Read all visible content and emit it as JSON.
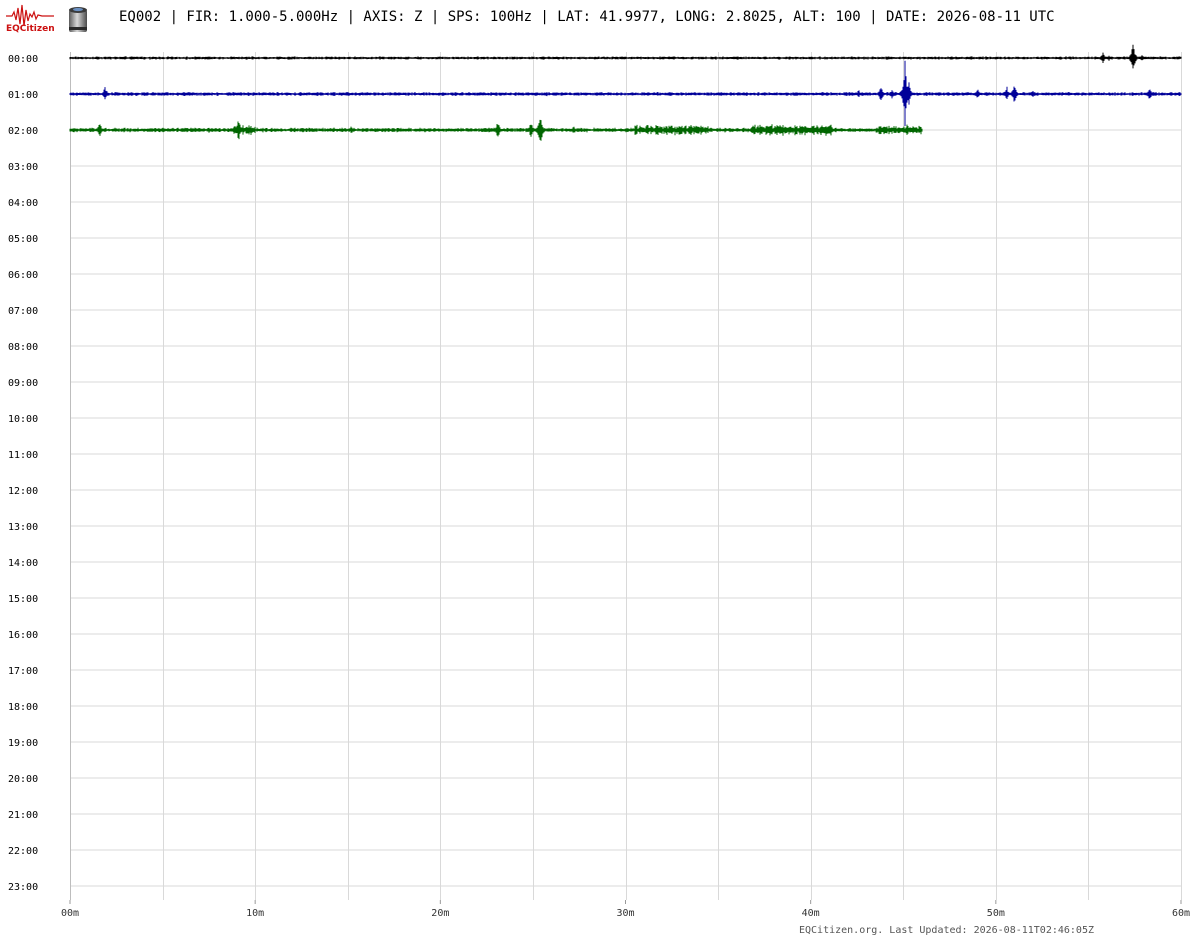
{
  "header": {
    "logo_text": "EQCitizen",
    "title": "EQ002 | FIR: 1.000-5.000Hz | AXIS: Z | SPS: 100Hz | LAT: 41.9977, LONG: 2.8025, ALT: 100 | DATE: 2026-08-11 UTC"
  },
  "footer": {
    "text": "EQCitizen.org. Last Updated: 2026-08-11T02:46:05Z"
  },
  "colors": {
    "grid": "#d9d9d9",
    "axis_text": "#000000",
    "trace_cycle": [
      "#000000",
      "#000099",
      "#006600"
    ],
    "logo_red": "#cc1111"
  },
  "chart_data": {
    "type": "line",
    "subtype": "helicorder",
    "row_labels": [
      "00:00",
      "01:00",
      "02:00",
      "03:00",
      "04:00",
      "05:00",
      "06:00",
      "07:00",
      "08:00",
      "09:00",
      "10:00",
      "11:00",
      "12:00",
      "13:00",
      "14:00",
      "15:00",
      "16:00",
      "17:00",
      "18:00",
      "19:00",
      "20:00",
      "21:00",
      "22:00",
      "23:00"
    ],
    "x_ticks": [
      {
        "value": 0,
        "label": "00m"
      },
      {
        "value": 10,
        "label": "10m"
      },
      {
        "value": 20,
        "label": "20m"
      },
      {
        "value": 30,
        "label": "30m"
      },
      {
        "value": 40,
        "label": "40m"
      },
      {
        "value": 50,
        "label": "50m"
      },
      {
        "value": 60,
        "label": "60m"
      }
    ],
    "x_range_minutes": [
      0,
      60
    ],
    "minor_grid_minutes": 5,
    "grid": true,
    "traces": [
      {
        "row": 0,
        "color": "#000000",
        "start_min": 0,
        "end_min": 60,
        "noise": 0.25,
        "spikes": [
          {
            "t": 55.8,
            "amp": 1.4
          },
          {
            "t": 56.1,
            "amp": 0.8
          },
          {
            "t": 57.4,
            "amp": 3.8
          },
          {
            "t": 57.9,
            "amp": 0.9
          }
        ]
      },
      {
        "row": 1,
        "color": "#000099",
        "start_min": 0,
        "end_min": 60,
        "noise": 0.3,
        "spikes": [
          {
            "t": 1.9,
            "amp": 1.8
          },
          {
            "t": 42.6,
            "amp": 1.0
          },
          {
            "t": 43.8,
            "amp": 2.2
          },
          {
            "t": 44.4,
            "amp": 1.2
          },
          {
            "t": 45.1,
            "amp": 8.0
          },
          {
            "t": 45.3,
            "amp": 3.0
          },
          {
            "t": 49.0,
            "amp": 1.4
          },
          {
            "t": 50.6,
            "amp": 1.6
          },
          {
            "t": 51.0,
            "amp": 2.6
          },
          {
            "t": 52.0,
            "amp": 0.8
          },
          {
            "t": 58.3,
            "amp": 1.8
          }
        ]
      },
      {
        "row": 2,
        "color": "#006600",
        "start_min": 0,
        "end_min": 46.0,
        "noise": 0.35,
        "spikes": [
          {
            "t": 1.6,
            "amp": 1.8
          },
          {
            "t": 7.5,
            "amp": 0.9
          },
          {
            "t": 9.1,
            "amp": 2.8
          },
          {
            "t": 15.2,
            "amp": 1.0
          },
          {
            "t": 23.1,
            "amp": 2.4
          },
          {
            "t": 24.9,
            "amp": 2.0
          },
          {
            "t": 25.4,
            "amp": 4.8
          },
          {
            "t": 27.2,
            "amp": 1.0
          },
          {
            "t": 31.2,
            "amp": 1.2
          },
          {
            "t": 37.3,
            "amp": 1.4
          },
          {
            "t": 41.0,
            "amp": 1.2
          },
          {
            "t": 45.2,
            "amp": 1.6
          }
        ],
        "bursts": [
          {
            "start": 8.8,
            "end": 10.0,
            "amp": 0.9
          },
          {
            "start": 30.5,
            "end": 34.5,
            "amp": 0.9
          },
          {
            "start": 36.8,
            "end": 41.2,
            "amp": 1.0
          },
          {
            "start": 43.5,
            "end": 46.0,
            "amp": 0.8
          }
        ]
      }
    ]
  }
}
